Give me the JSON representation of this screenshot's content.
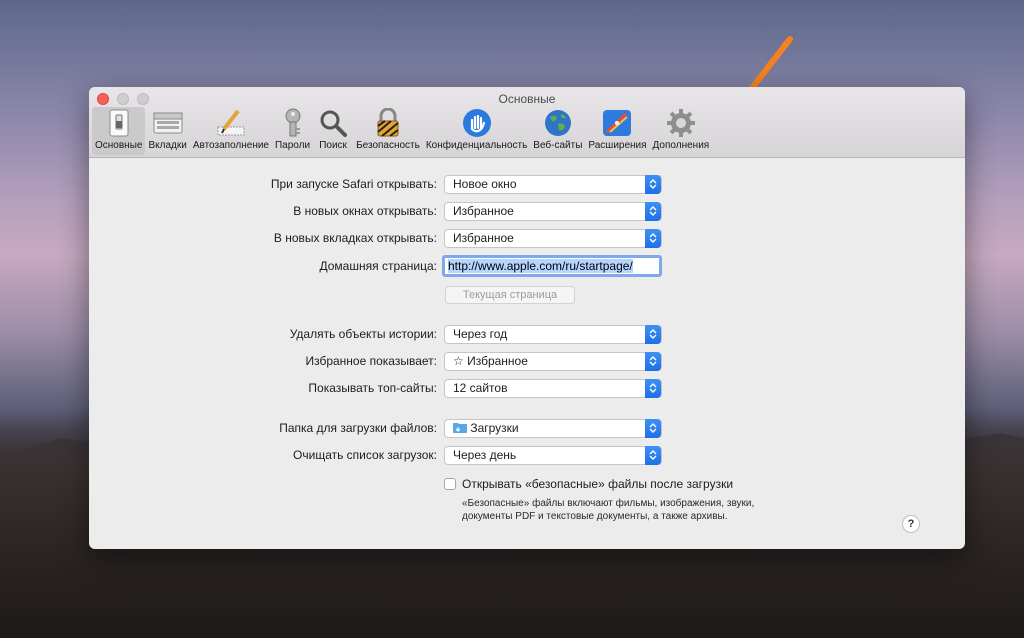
{
  "window": {
    "title": "Основные"
  },
  "tabs": [
    {
      "label": "Основные",
      "icon": "switch-icon"
    },
    {
      "label": "Вкладки",
      "icon": "tabs-icon"
    },
    {
      "label": "Автозаполнение",
      "icon": "pencil-icon"
    },
    {
      "label": "Пароли",
      "icon": "key-icon"
    },
    {
      "label": "Поиск",
      "icon": "magnifier-icon"
    },
    {
      "label": "Безопасность",
      "icon": "padlock-icon"
    },
    {
      "label": "Конфиденциальность",
      "icon": "hand-icon"
    },
    {
      "label": "Веб-сайты",
      "icon": "globe-icon"
    },
    {
      "label": "Расширения",
      "icon": "extensions-icon"
    },
    {
      "label": "Дополнения",
      "icon": "gear-icon"
    }
  ],
  "settings": {
    "launch": {
      "label": "При запуске Safari открывать:",
      "value": "Новое окно"
    },
    "new_windows": {
      "label": "В новых окнах открывать:",
      "value": "Избранное"
    },
    "new_tabs": {
      "label": "В новых вкладках открывать:",
      "value": "Избранное"
    },
    "homepage": {
      "label": "Домашняя страница:",
      "value": "http://www.apple.com/ru/startpage/"
    },
    "current_page_button": "Текущая страница",
    "history": {
      "label": "Удалять объекты истории:",
      "value": "Через год"
    },
    "favorites": {
      "label": "Избранное показывает:",
      "value": "Избранное"
    },
    "top_sites": {
      "label": "Показывать топ-сайты:",
      "value": "12 сайтов"
    },
    "download_folder": {
      "label": "Папка для загрузки файлов:",
      "value": "Загрузки"
    },
    "clear_downloads": {
      "label": "Очищать список загрузок:",
      "value": "Через день"
    },
    "open_safe": {
      "label": "Открывать «безопасные» файлы после загрузки",
      "checked": false
    },
    "safe_note": "«Безопасные» файлы включают фильмы, изображения, звуки, документы PDF и текстовые документы, а также архивы."
  },
  "help_label": "?",
  "colors": {
    "accent": "#1d6fe8",
    "arrow": "#f5821f",
    "close": "#fc5f57"
  }
}
